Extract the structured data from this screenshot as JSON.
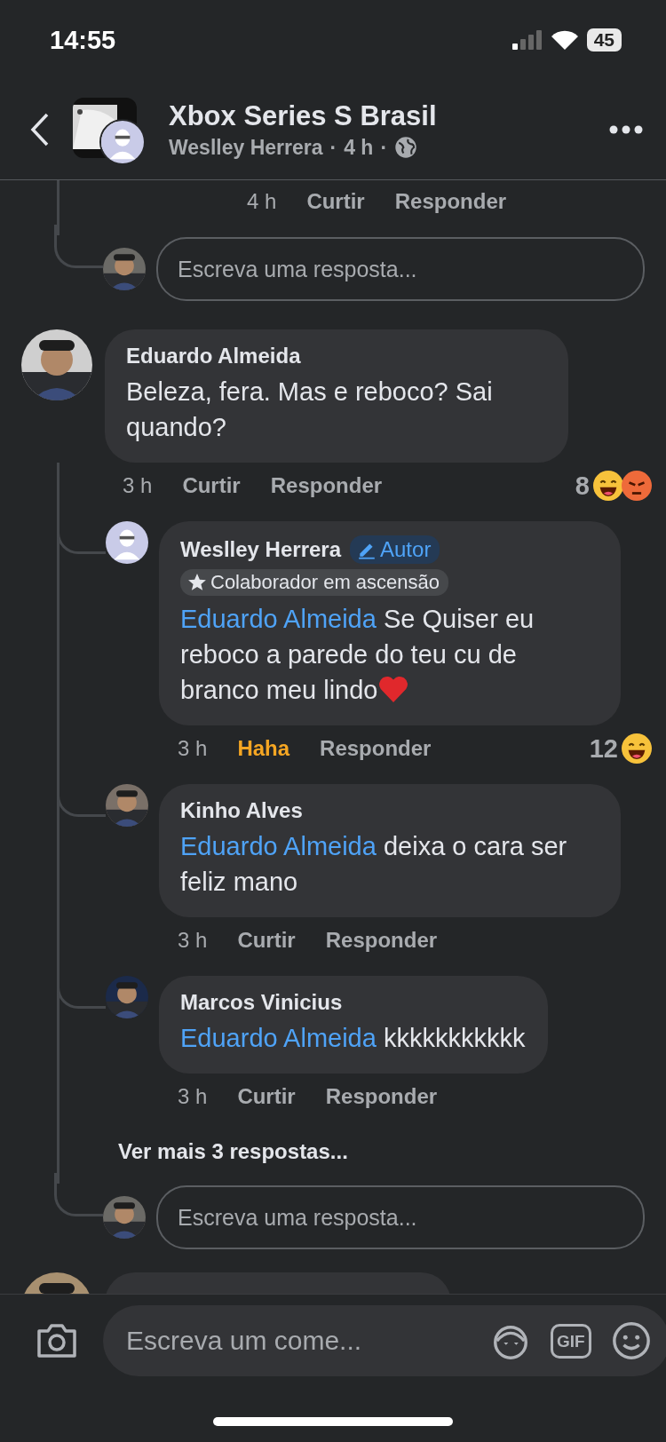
{
  "status_bar": {
    "time": "14:55",
    "battery": "45"
  },
  "header": {
    "title": "Xbox Series S Brasil",
    "author": "Weslley Herrera",
    "time": "4 h",
    "separator": "·"
  },
  "previous_thread": {
    "time": "4 h",
    "like": "Curtir",
    "liked": false,
    "reply": "Responder",
    "reply_placeholder": "Escreva uma resposta..."
  },
  "comment": {
    "author": "Eduardo Almeida",
    "text": "Beleza, fera. Mas e reboco? Sai quando?",
    "time": "3 h",
    "like": "Curtir",
    "liked": false,
    "reply": "Responder",
    "reaction_count": "8",
    "reactions": [
      {
        "kind": "haha"
      },
      {
        "kind": "angry"
      }
    ],
    "replies": [
      {
        "author": "Weslley Herrera",
        "avatar": {
          "kind": "silhouette"
        },
        "badges": [
          {
            "kind": "author",
            "label": "Autor"
          },
          {
            "kind": "rank",
            "label": "Colaborador em ascensão"
          }
        ],
        "mention": "Eduardo Almeida",
        "text": "Se Quiser eu reboco a parede do teu cu de branco meu lindo",
        "emoji": {
          "kind": "heart"
        },
        "time": "3 h",
        "like": "Haha",
        "liked": true,
        "reply": "Responder",
        "reaction_count": "12",
        "reactions": [
          {
            "kind": "haha"
          }
        ]
      },
      {
        "author": "Kinho Alves",
        "mention": "Eduardo Almeida",
        "text": "deixa o cara ser feliz mano",
        "time": "3 h",
        "like": "Curtir",
        "liked": false,
        "reply": "Responder"
      },
      {
        "author": "Marcos Vinicius",
        "mention": "Eduardo Almeida",
        "text": "kkkkkkkkkkk",
        "time": "3 h",
        "like": "Curtir",
        "liked": false,
        "reply": "Responder"
      }
    ],
    "more_replies": "Ver mais 3 respostas...",
    "reply_placeholder": "Escreva uma resposta..."
  },
  "composer": {
    "placeholder": "Escreva um come...",
    "gif": "GIF"
  }
}
